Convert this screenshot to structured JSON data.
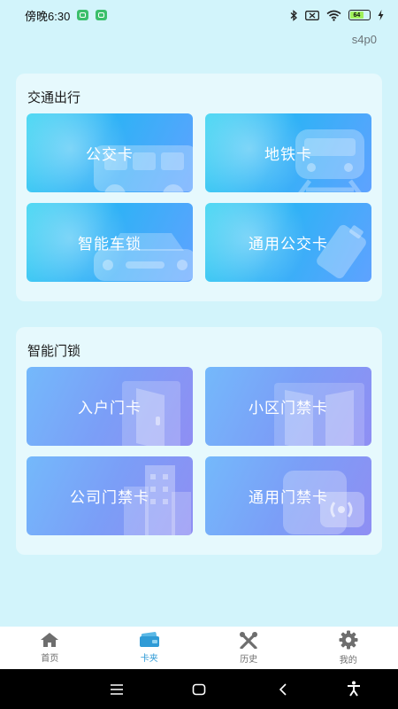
{
  "status_bar": {
    "time": "傍晚6:30",
    "battery_level": "64",
    "icons": [
      "wechat-icon",
      "wechat-icon",
      "bluetooth-icon",
      "mute-icon",
      "wifi-icon",
      "battery-icon",
      "charging-icon"
    ]
  },
  "version": "s4p0",
  "sections": [
    {
      "title": "交通出行",
      "cards": [
        {
          "label": "公交卡",
          "icon": "bus-icon"
        },
        {
          "label": "地铁卡",
          "icon": "subway-icon"
        },
        {
          "label": "智能车锁",
          "icon": "car-icon"
        },
        {
          "label": "通用公交卡",
          "icon": "card-icon"
        }
      ]
    },
    {
      "title": "智能门锁",
      "cards": [
        {
          "label": "入户门卡",
          "icon": "door-icon"
        },
        {
          "label": "小区门禁卡",
          "icon": "gate-icon"
        },
        {
          "label": "公司门禁卡",
          "icon": "building-icon"
        },
        {
          "label": "通用门禁卡",
          "icon": "nfc-icon"
        }
      ]
    }
  ],
  "bottom_nav": {
    "items": [
      {
        "label": "首页",
        "icon": "home-icon",
        "active": false
      },
      {
        "label": "卡夹",
        "icon": "wallet-icon",
        "active": true
      },
      {
        "label": "历史",
        "icon": "tools-icon",
        "active": false
      },
      {
        "label": "我的",
        "icon": "gear-icon",
        "active": false
      }
    ]
  },
  "colors": {
    "background": "#d2f4fb",
    "accent": "#2f9bd6",
    "transport_card": "#2fb2f6",
    "door_card": "#7b9ef7"
  }
}
